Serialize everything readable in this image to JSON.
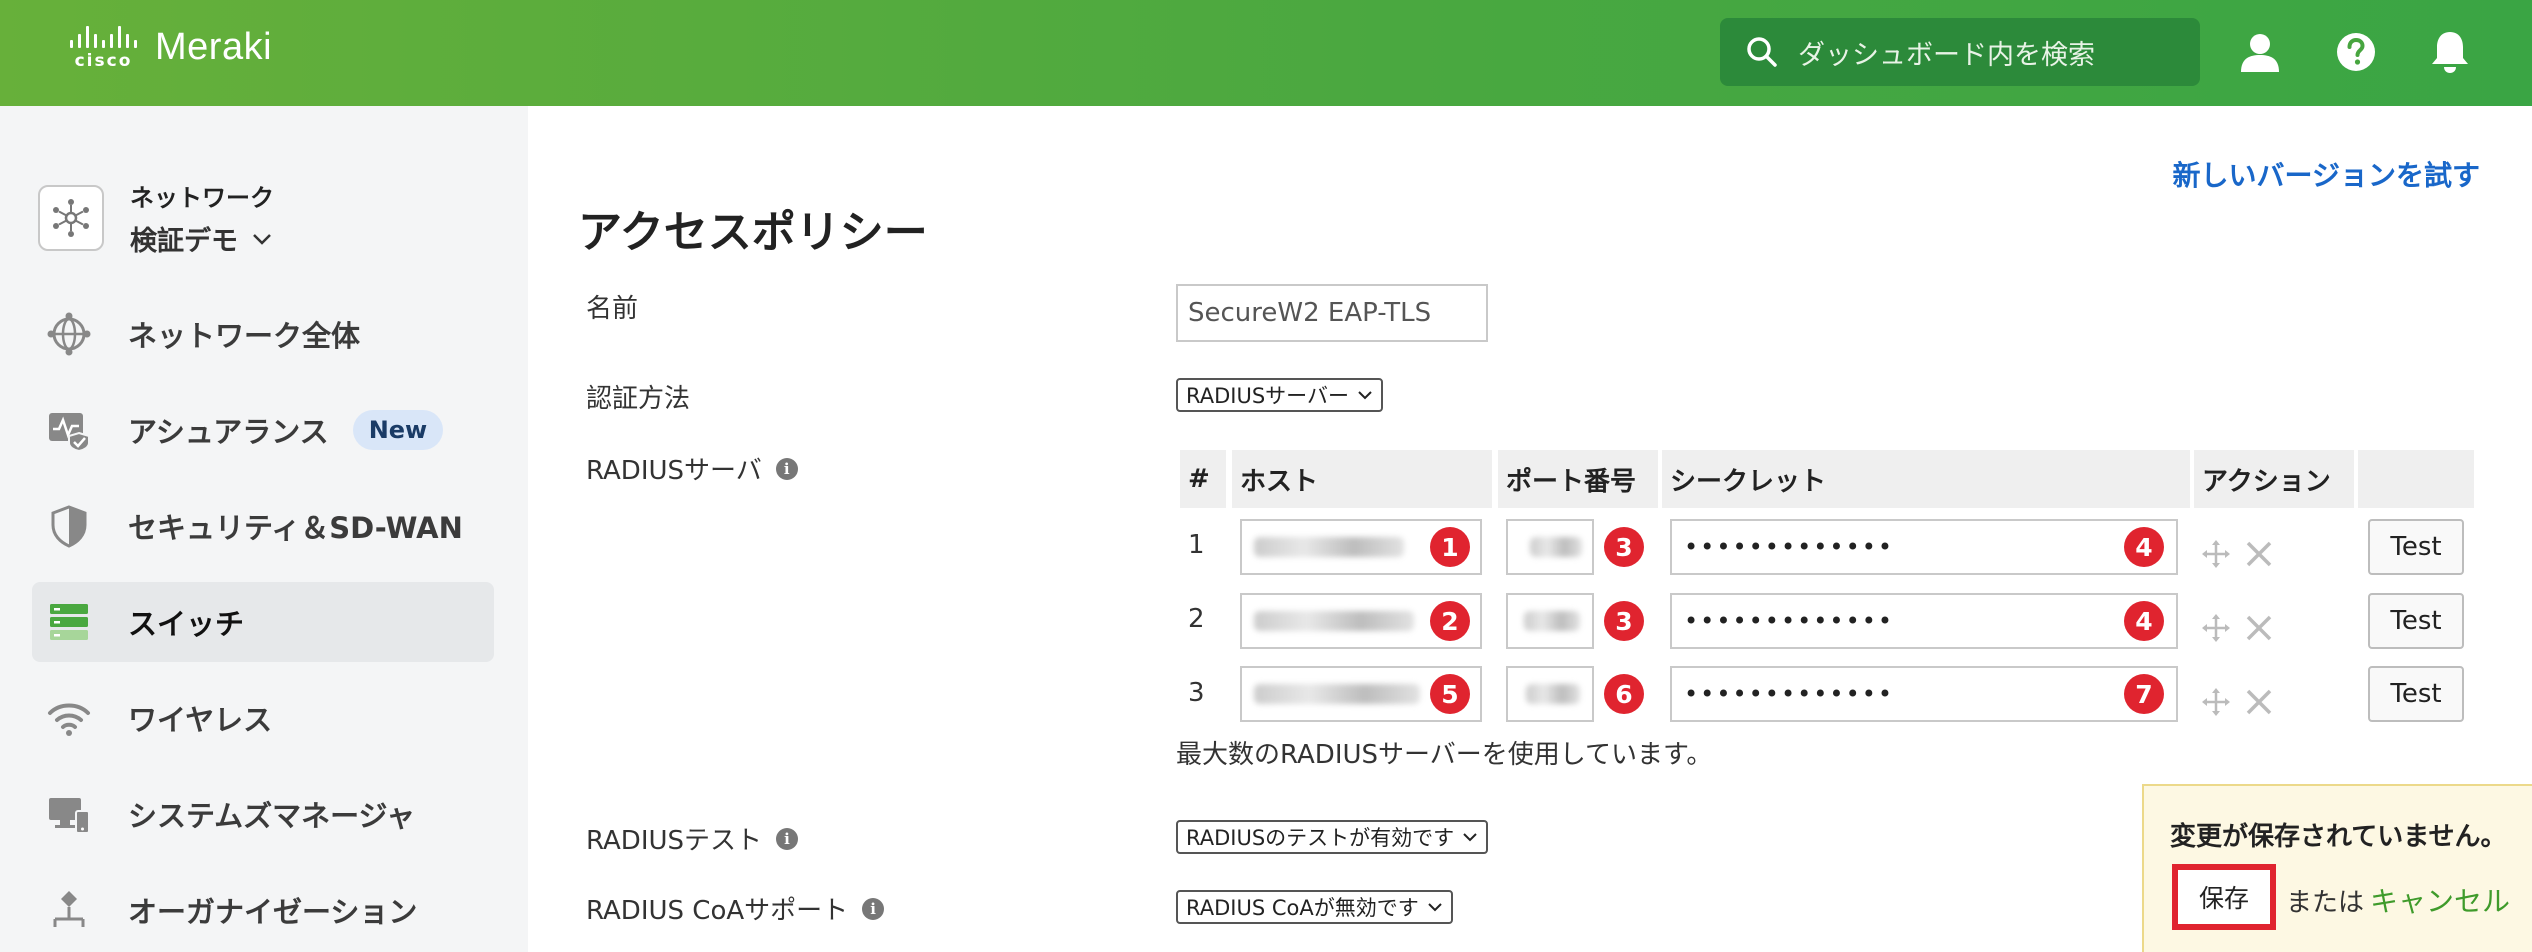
{
  "header": {
    "logo_cisco": "cisco",
    "logo_meraki": "Meraki",
    "search_placeholder": "ダッシュボード内を検索",
    "icons": [
      "user-icon",
      "help-icon",
      "bell-icon"
    ]
  },
  "sidebar": {
    "network_label": "ネットワーク",
    "network_name": "検証デモ",
    "items": [
      {
        "label": "ネットワーク全体",
        "icon": "network-wide-icon"
      },
      {
        "label": "アシュアランス",
        "icon": "assurance-icon",
        "badge": "New"
      },
      {
        "label": "セキュリティ＆SD-WAN",
        "icon": "shield-icon"
      },
      {
        "label": "スイッチ",
        "icon": "switch-icon",
        "active": true
      },
      {
        "label": "ワイヤレス",
        "icon": "wifi-icon"
      },
      {
        "label": "システムズマネージャ",
        "icon": "systems-manager-icon"
      },
      {
        "label": "オーガナイゼーション",
        "icon": "organization-icon"
      }
    ]
  },
  "main": {
    "try_new_version": "新しいバージョンを試す",
    "title": "アクセスポリシー",
    "name_label": "名前",
    "name_value": "SecureW2 EAP-TLS",
    "auth_label": "認証方法",
    "auth_value": "RADIUSサーバー",
    "radius_label": "RADIUSサーバ",
    "table": {
      "headers": [
        "#",
        "ホスト",
        "ポート番号",
        "シークレット",
        "アクション"
      ],
      "rows": [
        {
          "num": "1",
          "host_marker": "1",
          "port_marker": "3",
          "secret": "•••••••••••••",
          "secret_marker": "4",
          "test": "Test"
        },
        {
          "num": "2",
          "host_marker": "2",
          "port_marker": "3",
          "secret": "•••••••••••••",
          "secret_marker": "4",
          "test": "Test"
        },
        {
          "num": "3",
          "host_marker": "5",
          "port_marker": "6",
          "secret": "•••••••••••••",
          "secret_marker": "7",
          "test": "Test"
        }
      ]
    },
    "max_note": "最大数のRADIUSサーバーを使用しています。",
    "radius_test_label": "RADIUSテスト",
    "radius_test_value": "RADIUSのテストが有効です",
    "coa_label": "RADIUS CoAサポート",
    "coa_value": "RADIUS CoAが無効です"
  },
  "unsaved": {
    "message": "変更が保存されていません。",
    "save": "保存",
    "or": "または",
    "cancel": "キャンセル"
  },
  "colors": {
    "header_green": "#4aa840",
    "marker_red": "#e0242f",
    "link_blue": "#1967c9",
    "cancel_green": "#3f9b2b"
  }
}
